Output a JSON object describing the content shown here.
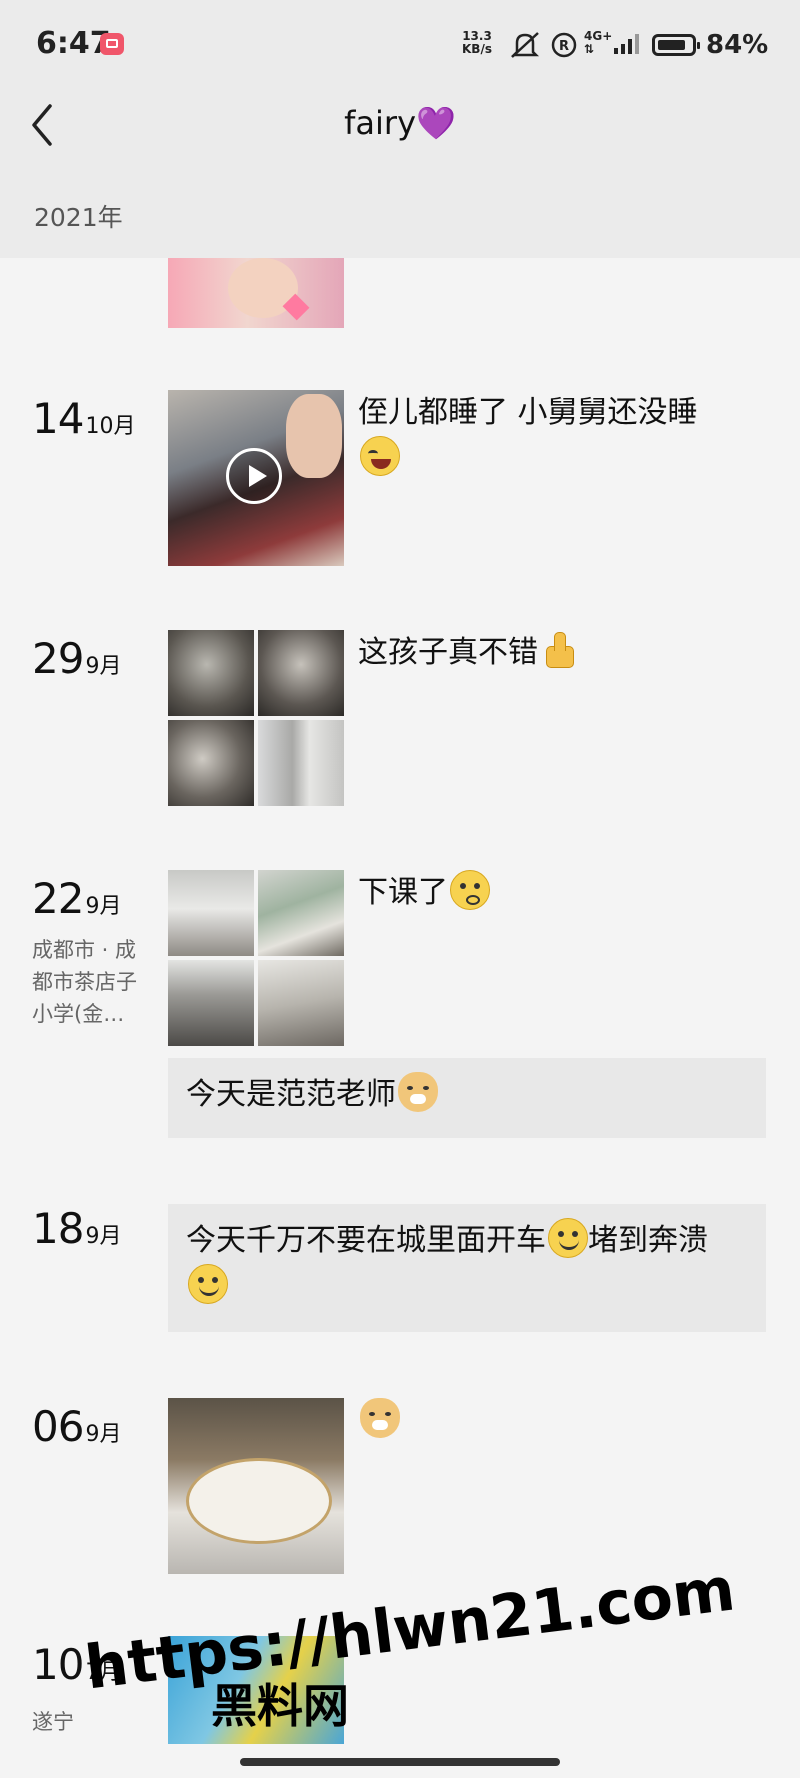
{
  "status_bar": {
    "time": "6:47",
    "net_speed_value": "13.3",
    "net_speed_unit": "KB/s",
    "network": "4G+",
    "battery_text": "84%",
    "battery_level": 0.84
  },
  "header": {
    "title": "fairy💜",
    "year_label": "2021年"
  },
  "posts": [
    {
      "day": "14",
      "month": "10月",
      "caption": "侄儿都睡了 小舅舅还没睡",
      "emoji": "laugh-cry-icon",
      "media": "video"
    },
    {
      "day": "29",
      "month": "9月",
      "caption": "这孩子真不错",
      "emoji": "thumbs-up-icon",
      "media": "4-photo-grid"
    },
    {
      "day": "22",
      "month": "9月",
      "location": "成都市 · 成都市茶店子小学(金…",
      "caption": "下课了",
      "emoji": "dizzy-face-icon",
      "media": "4-photo-grid"
    },
    {
      "text_only": "今天是范范老师",
      "emoji": "doge-icon"
    },
    {
      "day": "18",
      "month": "9月",
      "text_only_a": "今天千万不要在城里面开车",
      "text_only_b": "堵到奔溃",
      "emoji": "smile-icon",
      "media": "text"
    },
    {
      "day": "06",
      "month": "9月",
      "emoji": "doge-icon",
      "media": "photo"
    },
    {
      "day": "10",
      "month": "7月",
      "location": "遂宁",
      "media": "video"
    }
  ],
  "watermark": {
    "url": "https://hlwn21.com",
    "name": "黑料网"
  },
  "colors": {
    "header_bg": "#ebebeb",
    "page_bg": "#f4f4f4",
    "text_card_bg": "#e8e8e8"
  }
}
